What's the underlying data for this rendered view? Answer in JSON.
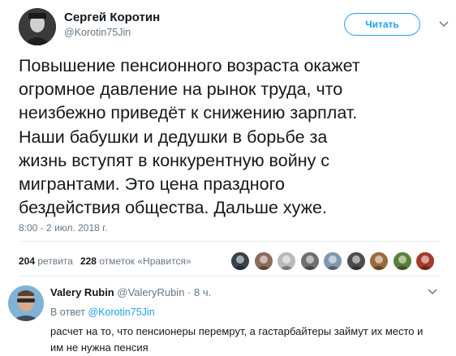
{
  "tweet": {
    "author_name": "Сергей Коротин",
    "author_handle": "@Korotin75Jin",
    "follow_label": "Читать",
    "text_lines": [
      "Повышение пенсионного возраста окажет",
      "огромное давление на рынок труда, что",
      "неизбежно приведёт к снижению зарплат.",
      "Наши бабушки и дедушки в борьбе за",
      "жизнь вступят в конкурентную войну с",
      "мигрантами. Это цена праздного",
      "бездействия общества. Дальше хуже."
    ],
    "timestamp": "8:00 - 2 июл. 2018 г.",
    "retweets_count": "204",
    "retweets_label": "ретвита",
    "likes_count": "228",
    "likes_label": "отметок «Нравится»",
    "liker_count": 9,
    "liker_colors": [
      "#35424f",
      "#8c6b5a",
      "#b9b9b9",
      "#6f6f6f",
      "#7f98ad",
      "#4d4d4d",
      "#9a6a3d",
      "#5b7f3a",
      "#a33a2a"
    ]
  },
  "reply": {
    "author_name": "Valery Rubin",
    "author_handle": "@ValeryRubin",
    "time": "· 8 ч.",
    "reply_to_prefix": "В ответ",
    "reply_to_handle": "@Korotin75Jin",
    "text_lines": [
      "расчет на то, что пенсионеры перемрут, а гастарбайтеры займут их место и",
      "им не нужна пенсия"
    ]
  },
  "colors": {
    "accent": "#1da1f2",
    "secondary_text": "#657786",
    "primary_text": "#14171a",
    "divider": "#e6ecf0"
  },
  "icons": [
    "chevron-down-icon",
    "chevron-down-icon"
  ]
}
